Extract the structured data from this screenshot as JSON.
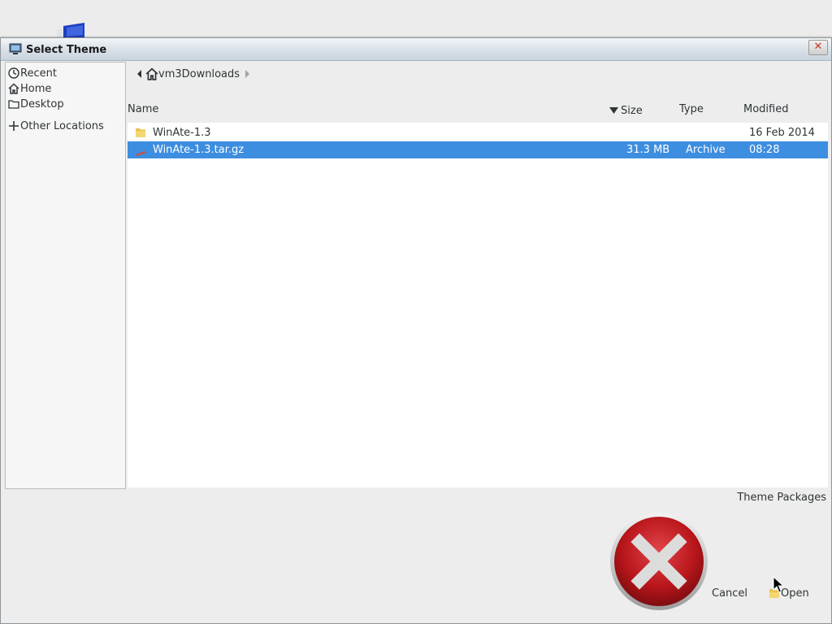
{
  "window": {
    "title": "Select Theme",
    "close_icon": "close-icon"
  },
  "sidebar": {
    "items": [
      {
        "label": "Recent",
        "icon": "clock-icon"
      },
      {
        "label": "Home",
        "icon": "home-icon"
      },
      {
        "label": "Desktop",
        "icon": "folder-icon"
      },
      {
        "label": "Other Locations",
        "icon": "plus-icon"
      }
    ]
  },
  "pathbar": {
    "back_icon": "chevron-left-icon",
    "current": "vm3Downloads",
    "forward_icon": "chevron-right-icon"
  },
  "columns": {
    "name": "Name",
    "size": "Size",
    "size_sort_icon": "sort-desc-icon",
    "type": "Type",
    "modified": "Modified"
  },
  "files": [
    {
      "name": "WinAte-1.3",
      "size": "",
      "type": "",
      "modified": "16 Feb 2014",
      "icon": "folder-icon",
      "selected": false
    },
    {
      "name": "WinAte-1.3.tar.gz",
      "size": "31.3 MB",
      "type": "Archive",
      "modified": "08:28",
      "icon": "archive-icon",
      "selected": true
    }
  ],
  "filter": {
    "label": "Theme Packages"
  },
  "buttons": {
    "cancel": "Cancel",
    "open": "Open"
  },
  "colors": {
    "selection": "#3d8ee0",
    "error_red": "#c0181c"
  }
}
